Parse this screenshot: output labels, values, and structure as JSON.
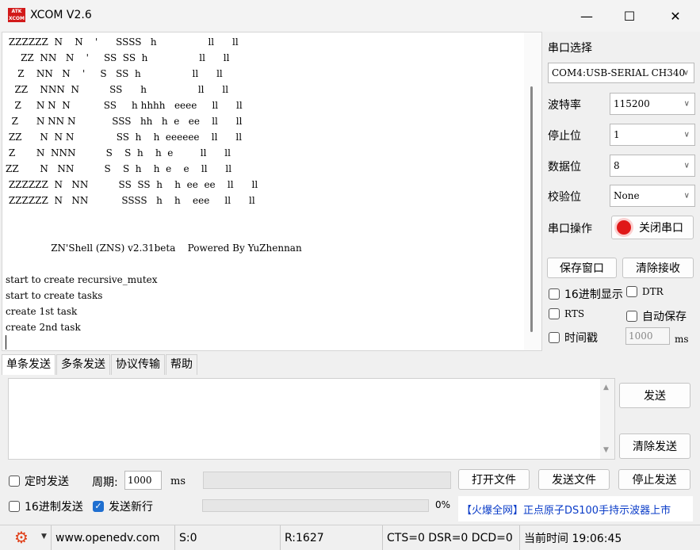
{
  "window": {
    "logo_text": "ATK XCOM",
    "title": "XCOM V2.6",
    "min_glyph": "—",
    "max_glyph": "☐",
    "close_glyph": "✕"
  },
  "terminal": {
    "lines": [
      " ZZZZZZ  N    N    '      SSSS   h                 ll      ll",
      "     ZZ  NN   N    '     SS  SS  h                 ll      ll",
      "    Z    NN   N    '     S   SS  h                 ll      ll",
      "   ZZ    NNN  N          SS      h                 ll      ll",
      "   Z     N N  N           SS     h hhhh   eeee     ll      ll",
      "  Z      N NN N            SSS   hh   h  e   ee    ll      ll",
      " ZZ      N  N N              SS  h    h  eeeeee    ll      ll",
      " Z       N  NNN          S    S  h    h  e         ll      ll",
      "ZZ       N   NN          S    S  h    h  e    e    ll      ll",
      " ZZZZZZ  N   NN          SS  SS  h    h  ee  ee    ll      ll",
      " ZZZZZZ  N   NN           SSSS   h    h    eee     ll      ll",
      "",
      "",
      "               ZN'Shell (ZNS) v2.31beta    Powered By YuZhennan",
      "",
      "start to create recursive_mutex",
      "start to create tasks",
      "create 1st task",
      "create 2nd task"
    ]
  },
  "side": {
    "port_select_label": "串口选择",
    "port_value": "COM4:USB-SERIAL CH340",
    "baud_label": "波特率",
    "baud_value": "115200",
    "stop_label": "停止位",
    "stop_value": "1",
    "data_label": "数据位",
    "data_value": "8",
    "parity_label": "校验位",
    "parity_value": "None",
    "port_op_label": "串口操作",
    "close_port_label": "关闭串口",
    "save_window_label": "保存窗口",
    "clear_recv_label": "清除接收",
    "hex_display_label": "16进制显示",
    "dtr_label": "DTR",
    "rts_label": "RTS",
    "auto_save_label": "自动保存",
    "timestamp_label": "时间戳",
    "timestamp_value": "1000",
    "timestamp_unit": "ms"
  },
  "tabs": [
    "单条发送",
    "多条发送",
    "协议传输",
    "帮助"
  ],
  "send": {
    "send_label": "发送",
    "clear_send_label": "清除发送",
    "timed_send_label": "定时发送",
    "period_label": "周期:",
    "period_value": "1000",
    "period_unit": "ms",
    "open_file_label": "打开文件",
    "send_file_label": "发送文件",
    "stop_send_label": "停止发送",
    "hex_send_label": "16进制发送",
    "newline_label": "发送新行",
    "progress_text": "0%",
    "progress_value": 0,
    "ad_text": "【火爆全网】正点原子DS100手持示波器上市"
  },
  "status": {
    "website": "www.openedv.com",
    "sent": "S:0",
    "received": "R:1627",
    "lines": "CTS=0 DSR=0 DCD=0",
    "time": "当前时间 19:06:45"
  },
  "colors": {
    "accent": "#1f6fd0",
    "logo": "#d21a1a",
    "ad": "#0a3cc8",
    "gear": "#e0401a"
  }
}
